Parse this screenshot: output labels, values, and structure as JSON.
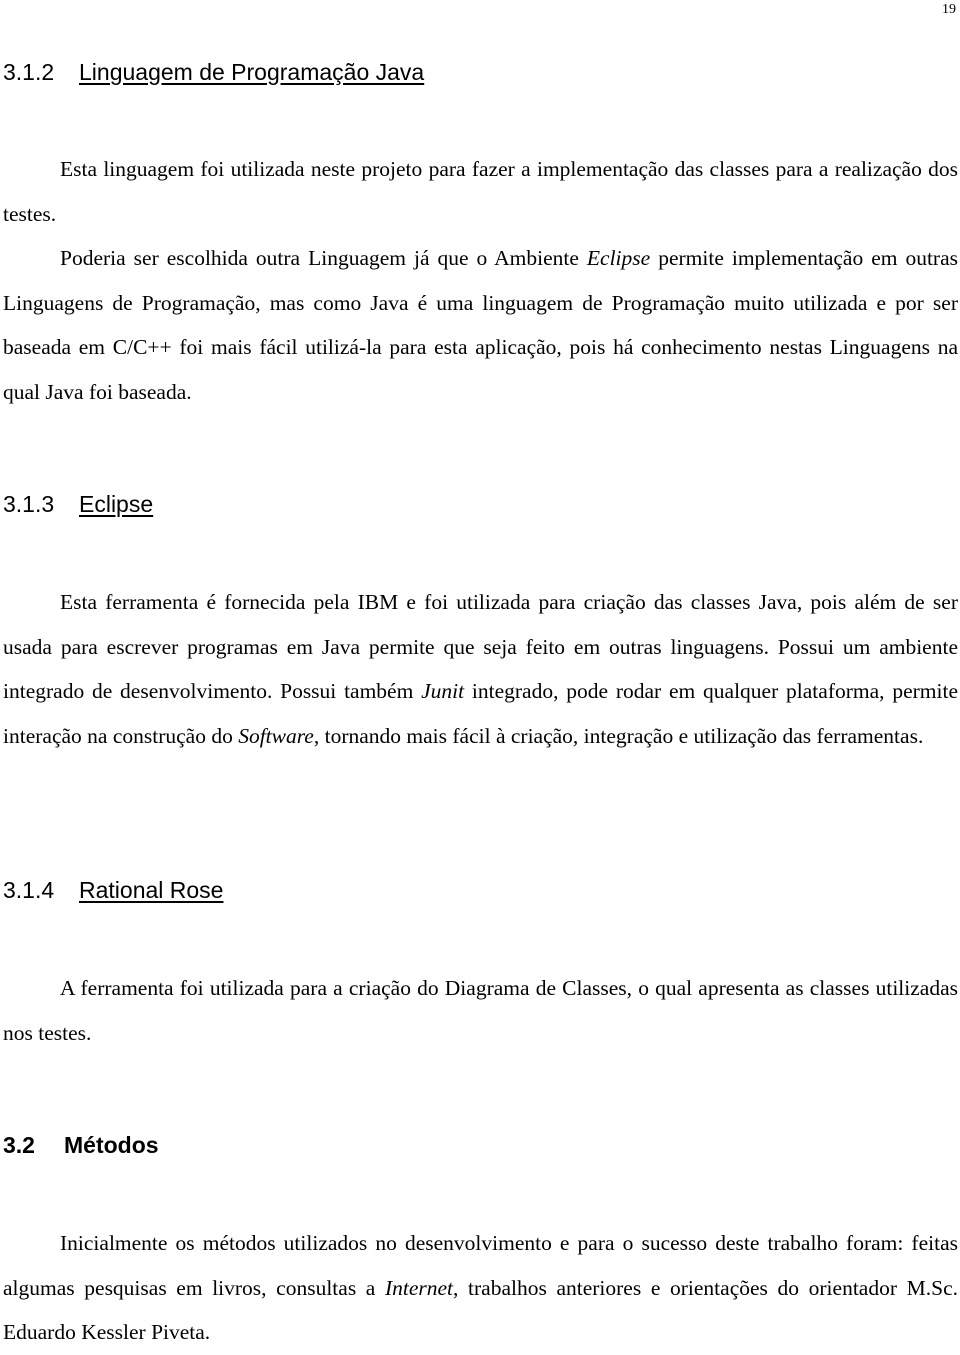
{
  "page": {
    "number": "19"
  },
  "sections": [
    {
      "id": "3-1-2",
      "number": "3.1.2",
      "title": "Linguagem de Programação Java",
      "paragraphs": [
        [
          {
            "text": "Esta linguagem foi utilizada neste projeto para fazer a implementação das classes para a realização dos testes."
          }
        ],
        [
          {
            "text": "Poderia ser escolhida outra Linguagem já que o Ambiente "
          },
          {
            "text": "Eclipse",
            "italic": true
          },
          {
            "text": " permite implementação em outras Linguagens de Programação, mas como Java é uma linguagem de Programação muito utilizada e por ser baseada em C/C++ foi mais fácil utilizá-la para esta aplicação, pois há conhecimento nestas Linguagens na qual Java foi baseada."
          }
        ]
      ]
    },
    {
      "id": "3-1-3",
      "number": "3.1.3",
      "title": "Eclipse",
      "paragraphs": [
        [
          {
            "text": "Esta ferramenta é fornecida pela IBM e foi utilizada para criação das classes Java, pois além de ser usada para escrever programas em Java permite que seja feito em outras linguagens. Possui um ambiente integrado de desenvolvimento. Possui também "
          },
          {
            "text": "Junit",
            "italic": true
          },
          {
            "text": " integrado, pode rodar em qualquer plataforma, permite interação na construção do "
          },
          {
            "text": "Software",
            "italic": true
          },
          {
            "text": ", tornando mais fácil à criação, integração e utilização das ferramentas."
          }
        ]
      ]
    },
    {
      "id": "3-1-4",
      "number": "3.1.4",
      "title": "Rational Rose",
      "paragraphs": [
        [
          {
            "text": "A ferramenta foi utilizada para a criação do Diagrama de Classes, o qual apresenta as classes utilizadas nos testes."
          }
        ]
      ]
    },
    {
      "id": "3-2",
      "number": "3.2",
      "title": "Métodos",
      "paragraphs": [
        [
          {
            "text": "Inicialmente os métodos utilizados no desenvolvimento e para o sucesso deste trabalho foram: feitas algumas pesquisas em livros, consultas a "
          },
          {
            "text": "Internet",
            "italic": true
          },
          {
            "text": ", trabalhos anteriores e orientações do orientador M.Sc. Eduardo Kessler Piveta."
          }
        ]
      ]
    }
  ]
}
